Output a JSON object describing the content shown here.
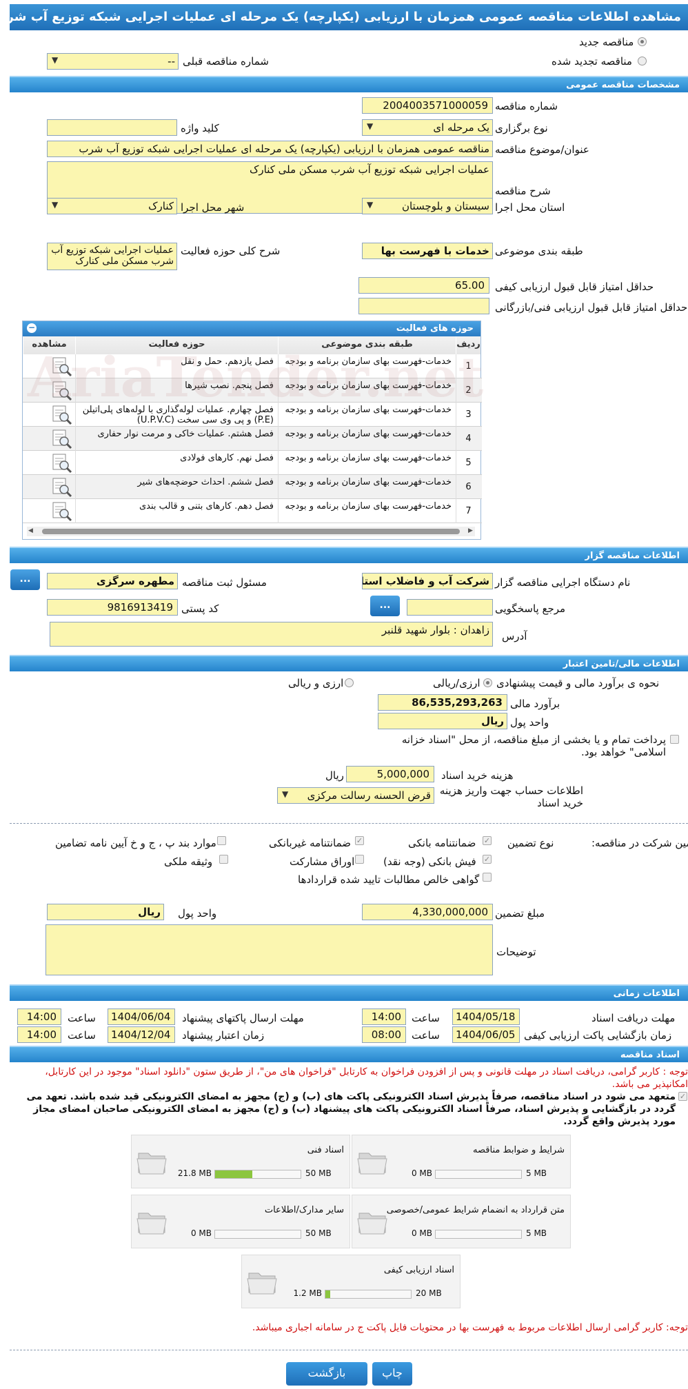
{
  "title": "مشاهده اطلاعات مناقصه عمومی همزمان با ارزیابی (یکپارچه) یک مرحله ای عملیات اجرایی شبکه توزیع آب شرب مسکن ملی کنارک",
  "top": {
    "new_tender": "مناقصه جدید",
    "renewed_tender": "مناقصه تجدید شده",
    "prev_number_label": "شماره مناقصه قبلی",
    "prev_number_value": "--"
  },
  "general": {
    "header": "مشخصات مناقصه عمومی",
    "number_label": "شماره مناقصه",
    "number_value": "2004003571000059",
    "type_label": "نوع برگزاری",
    "type_value": "یک مرحله ای",
    "keyword_label": "کلید واژه",
    "keyword_value": "",
    "subject_label": "عنوان/موضوع مناقصه",
    "subject_value": "مناقصه عمومی همزمان با ارزیابی (یکپارچه) یک مرحله ای عملیات اجرایی شبکه توزیع آب شرب",
    "desc_label": "شرح مناقصه",
    "desc_value": "عملیات اجرایی شبکه توزیع آب شرب  مسکن ملی کنارک",
    "province_label": "استان محل اجرا",
    "province_value": "سیستان و بلوچستان",
    "city_label": "شهر محل اجرا",
    "city_value": "کنارک",
    "category_label": "طبقه بندی موضوعی",
    "category_value": "خدمات با فهرست بها",
    "activity_desc_label": "شرح کلی حوزه فعالیت",
    "activity_desc_value": "عملیات اجرایی شبکه توزیع آب شرب  مسکن ملی کنارک",
    "min_quality_label": "حداقل امتیاز قابل قبول ارزیابی کیفی",
    "min_quality_value": "65.00",
    "min_tech_label": "حداقل امتیاز قابل قبول ارزیابی فنی/بازرگانی",
    "min_tech_value": ""
  },
  "activities": {
    "header": "حوزه های فعالیت",
    "columns": [
      "ردیف",
      "طبقه بندی موضوعی",
      "حوزه فعالیت",
      "مشاهده"
    ],
    "rows": [
      {
        "n": "1",
        "cat": "خدمات-فهرست بهای سازمان برنامه و بودجه",
        "field": "فصل یازدهم. حمل و نقل"
      },
      {
        "n": "2",
        "cat": "خدمات-فهرست بهای سازمان برنامه و بودجه",
        "field": "فصل پنجم. نصب شیرها"
      },
      {
        "n": "3",
        "cat": "خدمات-فهرست بهای سازمان برنامه و بودجه",
        "field": "فصل چهارم. عملیات لوله‌گذاری با لوله‌های پلی‌اتیلن (P.E) و پی وی سی سخت (U.P.V.C)"
      },
      {
        "n": "4",
        "cat": "خدمات-فهرست بهای سازمان برنامه و بودجه",
        "field": "فصل هشتم. عملیات خاکی و مرمت نوار حفاری"
      },
      {
        "n": "5",
        "cat": "خدمات-فهرست بهای سازمان برنامه و بودجه",
        "field": "فصل نهم. کارهای فولادی"
      },
      {
        "n": "6",
        "cat": "خدمات-فهرست بهای سازمان برنامه و بودجه",
        "field": "فصل ششم. احداث حوضچه‌های شیر"
      },
      {
        "n": "7",
        "cat": "خدمات-فهرست بهای سازمان برنامه و بودجه",
        "field": "فصل دهم. کارهای بتنی و قالب بندی"
      }
    ]
  },
  "organizer": {
    "header": "اطلاعات مناقصه گزار",
    "org_label": "نام دستگاه اجرایی مناقصه گزار",
    "org_value": "شرکت آب و فاضلاب استان",
    "resp_label": "مسئول ثبت مناقصه",
    "resp_value": "مطهره سرگزی",
    "ref_label": "مرجع پاسخگویی",
    "ref_value": "",
    "postal_label": "کد پستی",
    "postal_value": "9816913419",
    "address_label": "آدرس",
    "address_value": "زاهدان : بلوار شهید قلنبر",
    "dots": "..."
  },
  "finance": {
    "header": "اطلاعات مالی/تامین اعتبار",
    "method_label": "نحوه ی برآورد مالی و قیمت پیشنهادی",
    "opt_rial": "ارزی/ریالی",
    "opt_currency_rial": "ارزی و ریالی",
    "estimate_label": "برآورد مالی",
    "estimate_value": "86,535,293,263",
    "currency_label": "واحد پول",
    "currency_value": "ریال",
    "treasury_text": "پرداخت تمام و یا بخشی از مبلغ مناقصه، از محل \"اسناد خزانه اسلامی\" خواهد بود.",
    "doc_cost_label": "هزینه خرید اسناد",
    "doc_cost_value": "5,000,000",
    "doc_cost_unit": "ریال",
    "account_label": "اطلاعات حساب جهت واریز هزینه خرید اسناد",
    "account_value": "قرض الحسنه رسالت مرکزی"
  },
  "guarantee": {
    "participation_label": "تضمین شرکت در مناقصه:",
    "type_label": "نوع تضمین",
    "bank_guarantee": "ضمانتنامه بانکی",
    "nonbank_guarantee": "ضمانتنامه غیربانکی",
    "items_bpjk": "موارد بند پ ، ج و خ آیین نامه تضامین",
    "bank_receipt": "فیش بانکی (وجه نقد)",
    "bonds": "اوراق مشارکت",
    "property": "وثیقه ملکی",
    "net_claims": "گواهی خالص مطالبات تایید شده قراردادها",
    "amount_label": "مبلغ تضمین",
    "amount_value": "4,330,000,000",
    "unit_label": "واحد پول",
    "unit_value": "ریال",
    "notes_label": "توضیحات",
    "notes_value": ""
  },
  "timing": {
    "header": "اطلاعات زمانی",
    "receive_label": "مهلت دریافت اسناد",
    "receive_date": "1404/05/18",
    "receive_time": "14:00",
    "send_label": "مهلت ارسال پاکتهای پیشنهاد",
    "send_date": "1404/06/04",
    "send_time": "14:00",
    "open_label": "زمان بازگشایی پاکت ارزیابی کیفی",
    "open_date": "1404/06/05",
    "open_time": "08:00",
    "validity_label": "زمان اعتبار پیشنهاد",
    "validity_date": "1404/12/04",
    "validity_time": "14:00",
    "time_label": "ساعت"
  },
  "documents": {
    "header": "اسناد مناقصه",
    "note1": "توجه : کاربر گرامی، دریافت اسناد در مهلت قانونی و پس از افزودن فراخوان به کارتابل \"فراخوان های من\"، از طریق ستون \"دانلود اسناد\" موجود در این کارتابل، امکانپذیر می باشد.",
    "commit": "متعهد می شود در اسناد مناقصه، صرفاً پذیرش اسناد الکترونیکی پاکت های (ب) و (ج) مجهز به امضای الکترونیکی قید شده باشد. تعهد می گردد در بازگشایی و پذیرش اسناد، صرفاً اسناد الکترونیکی پاکت های پیشنهاد (ب) و (ج) مجهز به امضای الکترونیکی صاحبان امضای مجاز مورد پذیرش واقع گردد.",
    "files": [
      {
        "title": "شرایط و ضوابط مناقصه",
        "cur": "0 MB",
        "max": "5 MB",
        "fill": 0
      },
      {
        "title": "اسناد فنی",
        "cur": "21.8 MB",
        "max": "50 MB",
        "fill": 0.436
      },
      {
        "title": "متن قرارداد به انضمام شرایط عمومی/خصوصی",
        "cur": "0 MB",
        "max": "5 MB",
        "fill": 0
      },
      {
        "title": "سایر مدارک/اطلاعات",
        "cur": "0 MB",
        "max": "50 MB",
        "fill": 0
      },
      {
        "title": "اسناد ارزیابی کیفی",
        "cur": "1.2 MB",
        "max": "20 MB",
        "fill": 0.06
      }
    ],
    "note2": "توجه: کاربر گرامی ارسال اطلاعات مربوط به فهرست بها در محتویات فایل پاکت ج در سامانه اجباری میباشد."
  },
  "buttons": {
    "back": "بازگشت",
    "print": "چاپ"
  },
  "watermark": "AriaTender.net"
}
